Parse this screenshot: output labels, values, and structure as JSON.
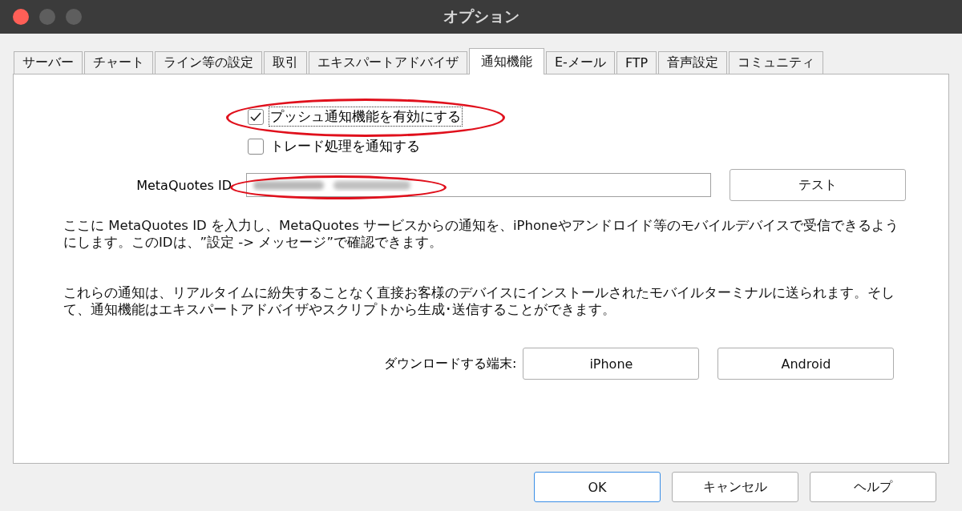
{
  "window": {
    "title": "オプション"
  },
  "tabs": [
    {
      "label": "サーバー",
      "selected": false
    },
    {
      "label": "チャート",
      "selected": false
    },
    {
      "label": "ライン等の設定",
      "selected": false
    },
    {
      "label": "取引",
      "selected": false
    },
    {
      "label": "エキスパートアドバイザ",
      "selected": false
    },
    {
      "label": "通知機能",
      "selected": true
    },
    {
      "label": "E-メール",
      "selected": false
    },
    {
      "label": "FTP",
      "selected": false
    },
    {
      "label": "音声設定",
      "selected": false
    },
    {
      "label": "コミュニティ",
      "selected": false
    }
  ],
  "checkboxes": [
    {
      "label": "プッシュ通知機能を有効にする",
      "checked": true,
      "focused": true
    },
    {
      "label": "トレード処理を通知する",
      "checked": false,
      "focused": false
    }
  ],
  "id_field": {
    "label": "MetaQuotes ID",
    "test_button": "テスト"
  },
  "paragraphs": [
    "ここに MetaQuotes ID を入力し、MetaQuotes サービスからの通知を、iPhoneやアンドロイド等のモバイルデバイスで受信できるようにします。このIDは、”設定 -> メッセージ”で確認できます。",
    "これらの通知は、リアルタイムに紛失することなく直接お客様のデバイスにインストールされたモバイルターミナルに送られます。そして、通知機能はエキスパートアドバイザやスクリプトから生成･送信することができます。"
  ],
  "download": {
    "label": "ダウンロードする端末:",
    "buttons": [
      "iPhone",
      "Android"
    ]
  },
  "footer_buttons": [
    {
      "label": "OK",
      "default": true
    },
    {
      "label": "キャンセル",
      "default": false
    },
    {
      "label": "ヘルプ",
      "default": false
    }
  ]
}
